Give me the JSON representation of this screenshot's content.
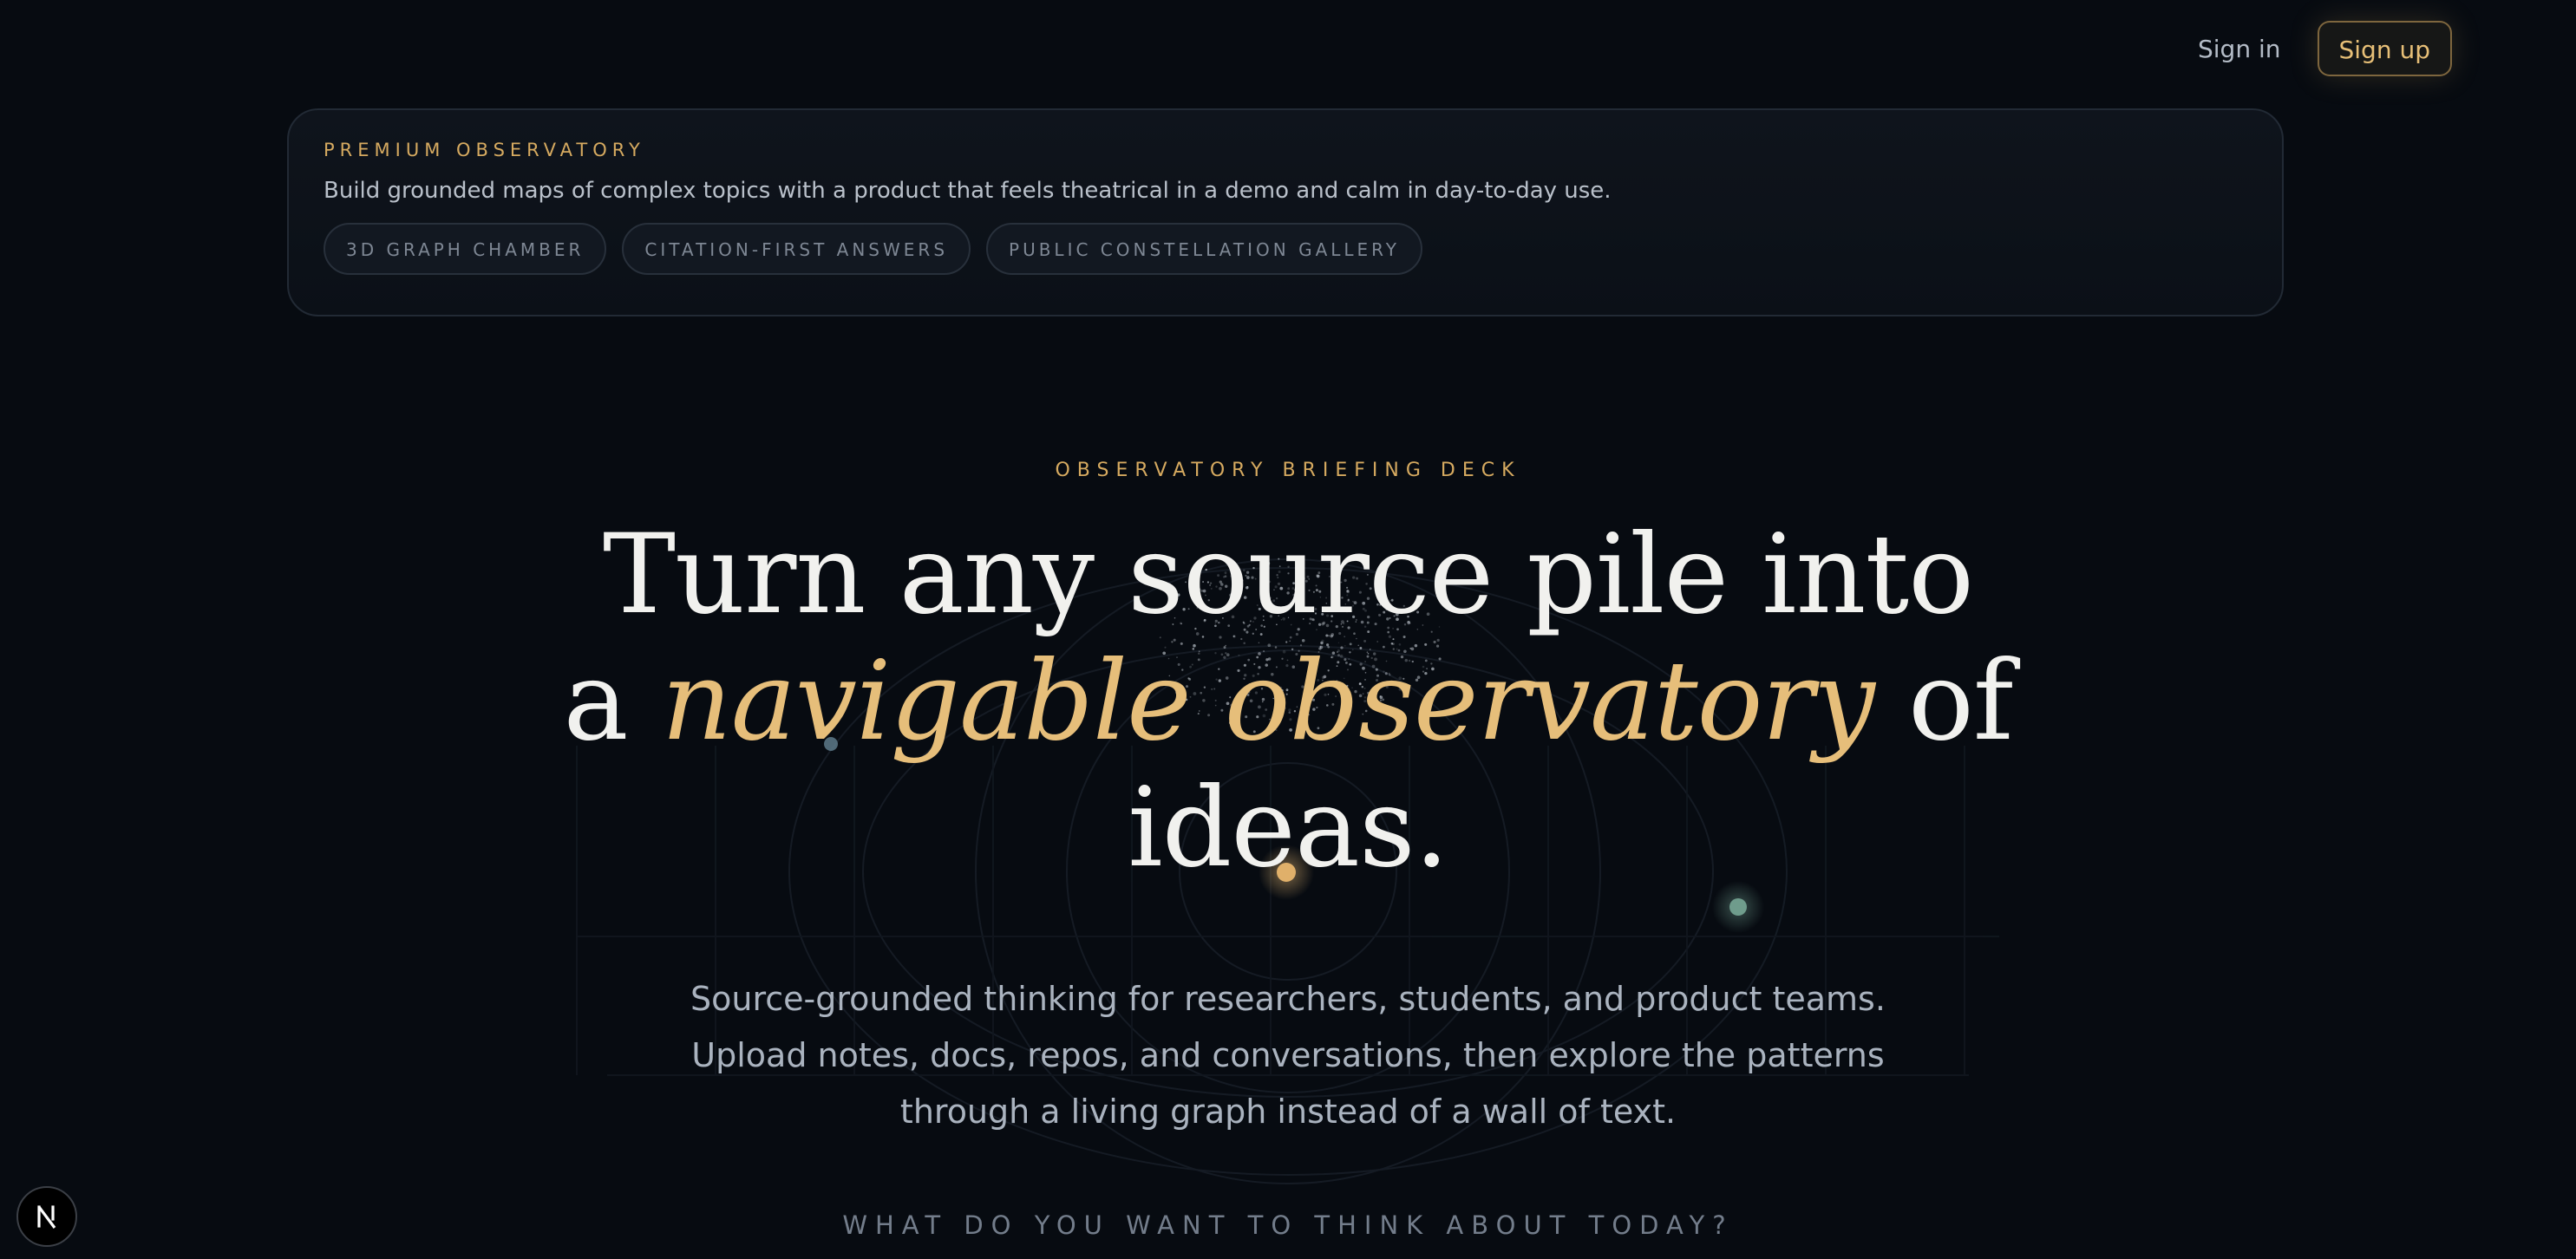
{
  "nav": {
    "signin_label": "Sign in",
    "signup_label": "Sign up"
  },
  "banner": {
    "eyebrow": "PREMIUM OBSERVATORY",
    "description": "Build grounded maps of complex topics with a product that feels theatrical in a demo and calm in day-to-day use.",
    "chips": [
      "3D GRAPH CHAMBER",
      "CITATION-FIRST ANSWERS",
      "PUBLIC CONSTELLATION GALLERY"
    ]
  },
  "hero": {
    "eyebrow": "OBSERVATORY BRIEFING DECK",
    "headline_line1": "Turn any source pile into",
    "headline_pre": "a ",
    "headline_highlight": "navigable observatory",
    "headline_post": " of",
    "headline_line3": "ideas.",
    "subcopy_line1": "Source-grounded thinking for researchers, students, and product teams.",
    "subcopy_line2": "Upload notes, docs, repos, and conversations, then explore the patterns",
    "subcopy_line3": "through a living graph instead of a wall of text.",
    "question": "WHAT DO YOU WANT TO THINK ABOUT TODAY?"
  },
  "colors": {
    "background": "#070b11",
    "accent_gold": "#d6aa60",
    "headline_gold": "#e6be7a",
    "node_teal": "#6f9c8c"
  },
  "icons": {
    "corner_badge": "n-logo-icon"
  }
}
